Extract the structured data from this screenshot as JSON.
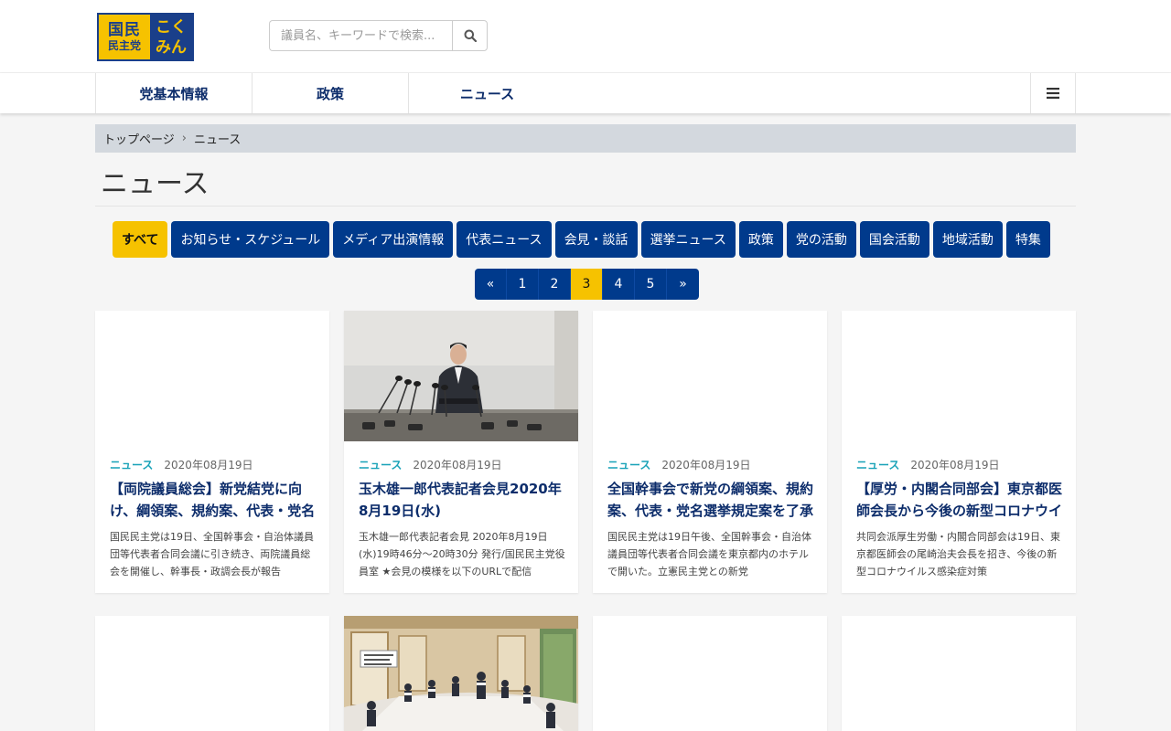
{
  "logo": {
    "line1": "国民",
    "line2": "民主党",
    "right1": "こく",
    "right2": "みん"
  },
  "search": {
    "placeholder": "議員名、キーワードで検索..."
  },
  "nav": {
    "items": [
      "党基本情報",
      "政策",
      "ニュース"
    ]
  },
  "breadcrumb": {
    "home": "トップページ",
    "sep": "›",
    "current": "ニュース"
  },
  "page_title": "ニュース",
  "categories": [
    "すべて",
    "お知らせ・スケジュール",
    "メディア出演情報",
    "代表ニュース",
    "会見・談話",
    "選挙ニュース",
    "政策",
    "党の活動",
    "国会活動",
    "地域活動",
    "特集"
  ],
  "pagination": [
    "«",
    "1",
    "2",
    "3",
    "4",
    "5",
    "»"
  ],
  "cards": [
    {
      "tag": "ニュース",
      "date": "2020年08月19日",
      "title": "【両院議員総会】新党結党に向け、綱領案、規約案、代表・党名選挙規定案を了承",
      "excerpt": "国民民主党は19日、全国幹事会・自治体議員団等代表者合同会議に引き続き、両院議員総会を開催し、幹事長・政調会長が報告"
    },
    {
      "tag": "ニュース",
      "date": "2020年08月19日",
      "title": "玉木雄一郎代表記者会見2020年8月19日(水)",
      "excerpt": "玉木雄一郎代表記者会見 2020年8月19日(水)19時46分～20時30分 発行/国民民主党役員室 ★会見の模様を以下のURLで配信"
    },
    {
      "tag": "ニュース",
      "date": "2020年08月19日",
      "title": "全国幹事会で新党の綱領案、規約案、代表・党名選挙規定案を了承",
      "excerpt": "国民民主党は19日午後、全国幹事会・自治体議員団等代表者合同会議を東京都内のホテルで開いた。立憲民主党との新党"
    },
    {
      "tag": "ニュース",
      "date": "2020年08月19日",
      "title": "【厚労・内閣合同部会】東京都医師会長から今後の新型コロナウイルス対策を聴取",
      "excerpt": "共同会派厚生労働・内閣合同部会は19日、東京都医師会の尾崎治夫会長を招き、今後の新型コロナウイルス感染症対策"
    }
  ]
}
